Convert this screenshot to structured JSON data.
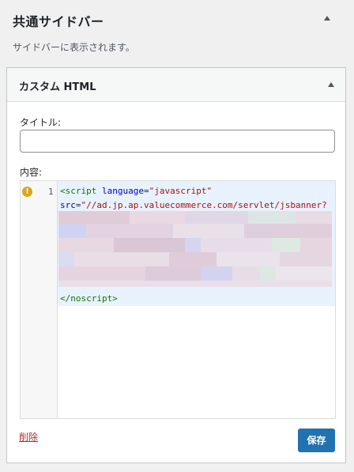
{
  "sidebar": {
    "title": "共通サイドバー",
    "description": "サイドバーに表示されます。"
  },
  "widget": {
    "title": "カスタム HTML",
    "title_label": "タイトル:",
    "title_value": "",
    "content_label": "内容:",
    "editor": {
      "warning_icon": "!",
      "line_number": "1",
      "code_line_1_tag": "<script ",
      "code_line_1_attr": "language",
      "code_line_1_eq": "=",
      "code_line_1_value": "\"javascript\"",
      "code_line_2_attr": "src",
      "code_line_2_eq": "=",
      "code_line_2_value": "\"//ad.jp.ap.valuecommerce.com/servlet/jsbanner?",
      "code_line_last": "</noscript>"
    },
    "delete_label": "削除",
    "save_label": "保存"
  },
  "colors": {
    "accent": "#2271b1",
    "delete": "#b32d2e",
    "warning": "#dba617",
    "editor_highlight": "#e8f2fd"
  },
  "icons": {
    "collapse": "triangle-up-icon",
    "warning": "warning-icon"
  }
}
